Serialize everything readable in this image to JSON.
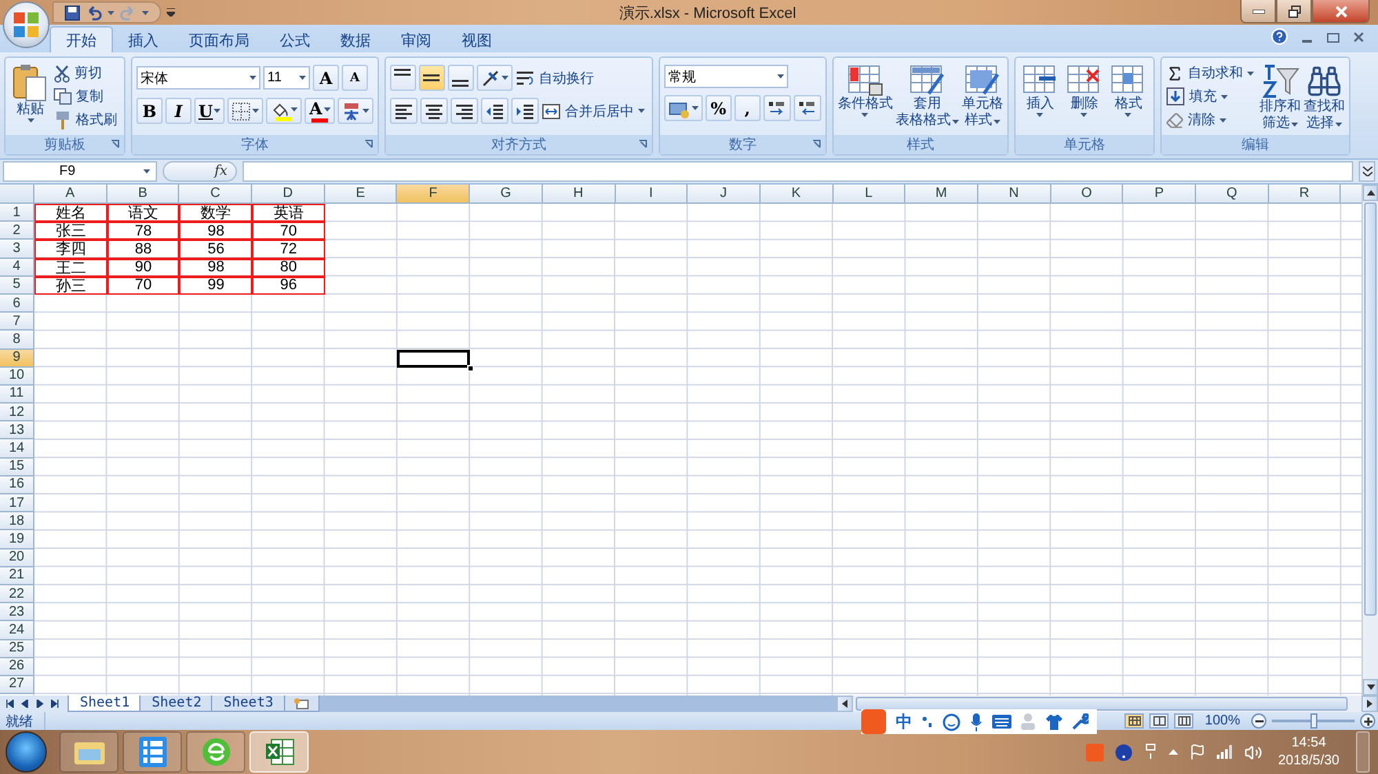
{
  "title_bar": {
    "title": "演示.xlsx - Microsoft Excel"
  },
  "ribbon_tabs": [
    {
      "label": "开始",
      "selected": true
    },
    {
      "label": "插入",
      "selected": false
    },
    {
      "label": "页面布局",
      "selected": false
    },
    {
      "label": "公式",
      "selected": false
    },
    {
      "label": "数据",
      "selected": false
    },
    {
      "label": "审阅",
      "selected": false
    },
    {
      "label": "视图",
      "selected": false
    }
  ],
  "ribbon_groups": [
    {
      "label": "剪贴板",
      "launcher": true,
      "sections": [
        {
          "kind": "large",
          "lines": [
            "粘贴"
          ],
          "dropdown": true
        },
        {
          "kind": "stack",
          "items": [
            {
              "kind": "small",
              "label": "剪切"
            },
            {
              "kind": "small",
              "label": "复制"
            },
            {
              "kind": "small",
              "label": "格式刷"
            }
          ]
        }
      ]
    },
    {
      "label": "字体",
      "launcher": true,
      "sections": [
        {
          "kind": "rows",
          "rows": [
            [
              {
                "kind": "font-box",
                "value": "宋体"
              },
              {
                "kind": "size-box",
                "value": "11"
              },
              {
                "kind": "icon_text",
                "label": "A"
              },
              {
                "kind": "icon_text",
                "label": "A",
                "small": true
              }
            ],
            [
              {
                "kind": "icon_text",
                "label": "B"
              },
              {
                "kind": "icon_text",
                "label": "I",
                "italic": true
              },
              {
                "kind": "icon_text",
                "label": "U",
                "underline": true,
                "dropdown": true
              },
              {
                "kind": "icon",
                "dropdown": true
              },
              {
                "kind": "icon",
                "dropdown": true,
                "color": "#ffff00"
              },
              {
                "kind": "icon_text",
                "label": "A",
                "dropdown": true,
                "color": "#ff0000"
              },
              {
                "kind": "icon",
                "dropdown": true
              }
            ]
          ]
        }
      ]
    },
    {
      "label": "对齐方式",
      "launcher": true,
      "sections": [
        {
          "kind": "rows",
          "rows": [
            [
              {
                "kind": "icon",
                "selected": false
              },
              {
                "kind": "icon",
                "selected": true
              },
              {
                "kind": "icon",
                "selected": false
              },
              {
                "kind": "icon",
                "dropdown": true
              },
              {
                "kind": "small",
                "label": "自动换行"
              }
            ],
            [
              {
                "kind": "icon",
                "selected": false
              },
              {
                "kind": "icon",
                "selected": false
              },
              {
                "kind": "icon",
                "selected": false
              },
              {
                "kind": "icon"
              },
              {
                "kind": "icon"
              },
              {
                "kind": "small",
                "label": "合并后居中",
                "dropdown": true
              }
            ]
          ]
        }
      ]
    },
    {
      "label": "数字",
      "launcher": true,
      "sections": [
        {
          "kind": "rows",
          "rows": [
            [
              {
                "kind": "format-box",
                "value": "常规"
              }
            ],
            [
              {
                "kind": "icon",
                "dropdown": true
              },
              {
                "kind": "icon_text",
                "label": "%"
              },
              {
                "kind": "icon_text",
                "label": ","
              },
              {
                "kind": "icon"
              },
              {
                "kind": "icon"
              }
            ]
          ]
        }
      ]
    },
    {
      "label": "样式",
      "launcher": false,
      "sections": [
        {
          "kind": "large",
          "lines": [
            "条件格式"
          ],
          "dropdown": true
        },
        {
          "kind": "large",
          "lines": [
            "套用",
            "表格格式"
          ],
          "dropdown": true
        },
        {
          "kind": "large",
          "lines": [
            "单元格",
            "样式"
          ],
          "dropdown": true
        }
      ]
    },
    {
      "label": "单元格",
      "launcher": false,
      "sections": [
        {
          "kind": "large",
          "lines": [
            "插入"
          ],
          "dropdown": true
        },
        {
          "kind": "large",
          "lines": [
            "删除"
          ],
          "dropdown": true
        },
        {
          "kind": "large",
          "lines": [
            "格式"
          ],
          "dropdown": true
        }
      ]
    },
    {
      "label": "编辑",
      "launcher": false,
      "sections": [
        {
          "kind": "stack",
          "items": [
            {
              "kind": "small",
              "label": "自动求和",
              "dropdown": true
            },
            {
              "kind": "small",
              "label": "填充",
              "dropdown": true
            },
            {
              "kind": "small",
              "label": "清除",
              "dropdown": true
            }
          ]
        },
        {
          "kind": "large",
          "lines": [
            "排序和",
            "筛选"
          ],
          "dropdown": true
        },
        {
          "kind": "large",
          "lines": [
            "查找和",
            "选择"
          ],
          "dropdown": true
        }
      ]
    }
  ],
  "formula_bar": {
    "name_box": "F9",
    "fx": "fx"
  },
  "sheet": {
    "columns": [
      {
        "label": "A",
        "selected": false
      },
      {
        "label": "B",
        "selected": false
      },
      {
        "label": "C",
        "selected": false
      },
      {
        "label": "D",
        "selected": false
      },
      {
        "label": "E",
        "selected": false
      },
      {
        "label": "F",
        "selected": true
      },
      {
        "label": "G",
        "selected": false
      },
      {
        "label": "H",
        "selected": false
      },
      {
        "label": "I",
        "selected": false
      },
      {
        "label": "J",
        "selected": false
      },
      {
        "label": "K",
        "selected": false
      },
      {
        "label": "L",
        "selected": false
      },
      {
        "label": "M",
        "selected": false
      },
      {
        "label": "N",
        "selected": false
      },
      {
        "label": "O",
        "selected": false
      },
      {
        "label": "P",
        "selected": false
      },
      {
        "label": "Q",
        "selected": false
      },
      {
        "label": "R",
        "selected": false
      }
    ],
    "rows": [
      {
        "label": "1",
        "selected": false
      },
      {
        "label": "2",
        "selected": false
      },
      {
        "label": "3",
        "selected": false
      },
      {
        "label": "4",
        "selected": false
      },
      {
        "label": "5",
        "selected": false
      },
      {
        "label": "6",
        "selected": false
      },
      {
        "label": "7",
        "selected": false
      },
      {
        "label": "8",
        "selected": false
      },
      {
        "label": "9",
        "selected": true
      },
      {
        "label": "10",
        "selected": false
      },
      {
        "label": "11",
        "selected": false
      },
      {
        "label": "12",
        "selected": false
      },
      {
        "label": "13",
        "selected": false
      },
      {
        "label": "14",
        "selected": false
      },
      {
        "label": "15",
        "selected": false
      },
      {
        "label": "16",
        "selected": false
      },
      {
        "label": "17",
        "selected": false
      },
      {
        "label": "18",
        "selected": false
      },
      {
        "label": "19",
        "selected": false
      },
      {
        "label": "20",
        "selected": false
      },
      {
        "label": "21",
        "selected": false
      },
      {
        "label": "22",
        "selected": false
      },
      {
        "label": "23",
        "selected": false
      },
      {
        "label": "24",
        "selected": false
      },
      {
        "label": "25",
        "selected": false
      },
      {
        "label": "26",
        "selected": false
      },
      {
        "label": "27",
        "selected": false
      }
    ],
    "data_bordered": true,
    "data": [
      [
        "姓名",
        "语文",
        "数学",
        "英语"
      ],
      [
        "张三",
        "78",
        "98",
        "70"
      ],
      [
        "李四",
        "88",
        "56",
        "72"
      ],
      [
        "王二",
        "90",
        "98",
        "80"
      ],
      [
        "孙三",
        "70",
        "99",
        "96"
      ]
    ]
  },
  "sheet_tabs": [
    {
      "label": "Sheet1",
      "selected": true
    },
    {
      "label": "Sheet2",
      "selected": false
    },
    {
      "label": "Sheet3",
      "selected": false
    }
  ],
  "status_bar": {
    "status": "就绪",
    "zoom": "100%",
    "zoom_level": {
      "level": 0.5
    },
    "views": [
      {
        "selected": true
      },
      {
        "selected": false
      },
      {
        "selected": false
      }
    ]
  },
  "ime_bar": {
    "mode": "中"
  },
  "taskbar": {
    "apps": [
      {
        "selected": false
      },
      {
        "selected": false
      },
      {
        "selected": false
      },
      {
        "selected": true
      }
    ],
    "time": "14:54",
    "date": "2018/5/30"
  }
}
